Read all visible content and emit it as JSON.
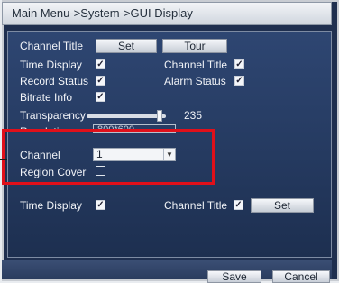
{
  "window": {
    "title": "Main Menu->System->GUI Display"
  },
  "channel_title": {
    "label": "Channel Title",
    "set_label": "Set",
    "tour_label": "Tour"
  },
  "options": {
    "time_display": {
      "label": "Time Display",
      "checked": true
    },
    "channel_title": {
      "label": "Channel Title",
      "checked": true
    },
    "record_status": {
      "label": "Record Status",
      "checked": true
    },
    "alarm_status": {
      "label": "Alarm Status",
      "checked": true
    },
    "bitrate_info": {
      "label": "Bitrate Info",
      "checked": true
    }
  },
  "transparency": {
    "label": "Transparency",
    "value": "235",
    "min": 0,
    "max": 255
  },
  "resolution": {
    "label": "Resolution",
    "value": "800*600"
  },
  "channel": {
    "label": "Channel",
    "value": "1"
  },
  "region_cover": {
    "label": "Region Cover",
    "checked": false
  },
  "overlay": {
    "time_display": {
      "label": "Time Display",
      "checked": true
    },
    "channel_title": {
      "label": "Channel Title",
      "checked": true
    },
    "set_label": "Set"
  },
  "footer": {
    "save_label": "Save",
    "cancel_label": "Cancel"
  },
  "check_mark": "✓",
  "dropdown_arrow": "▼",
  "colors": {
    "highlight": "#e0101a",
    "panel": "#2b4270"
  }
}
